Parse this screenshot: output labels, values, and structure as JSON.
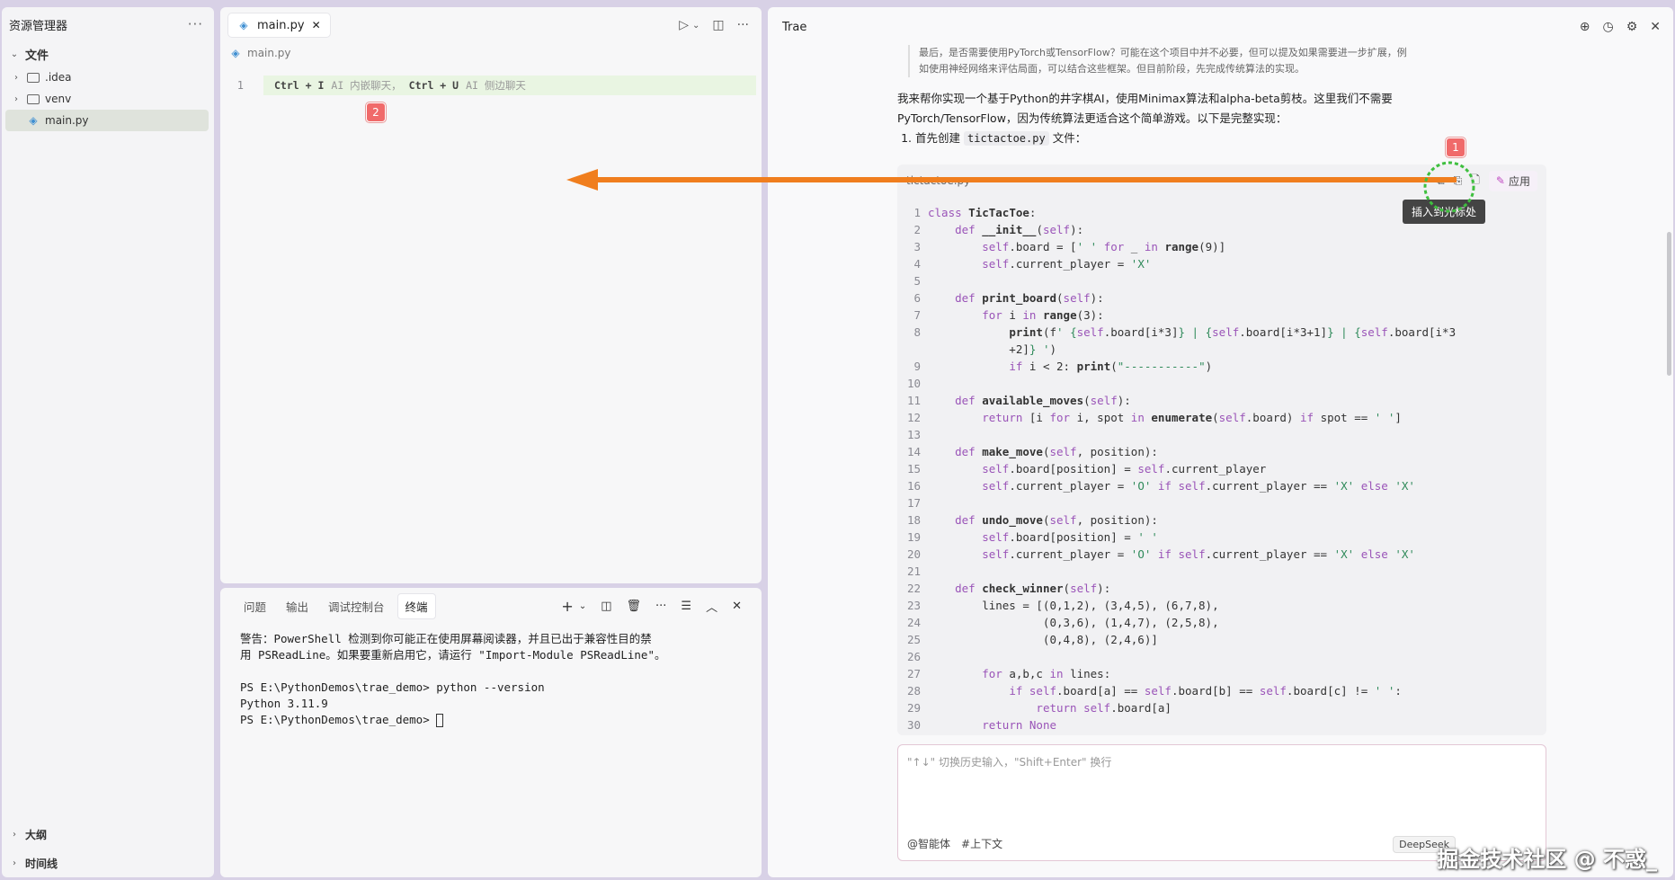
{
  "explorer": {
    "title": "资源管理器",
    "more": "···",
    "section": "文件",
    "items": [
      {
        "label": ".idea",
        "type": "folder"
      },
      {
        "label": "venv",
        "type": "folder"
      },
      {
        "label": "main.py",
        "type": "file"
      }
    ],
    "bottom": [
      {
        "label": "大纲"
      },
      {
        "label": "时间线"
      }
    ]
  },
  "editor": {
    "tab_label": "main.py",
    "tab_close": "✕",
    "breadcrumb": "main.py",
    "line_number": "1",
    "hint_key1": "Ctrl + I",
    "hint_text1": "AI 内嵌聊天，",
    "hint_key2": "Ctrl + U",
    "hint_text2": "AI 侧边聊天",
    "marker2": "2"
  },
  "terminal": {
    "tabs": [
      "问题",
      "输出",
      "调试控制台",
      "终端"
    ],
    "active_tab": "终端",
    "lines": [
      "警告：PowerShell 检测到你可能正在使用屏幕阅读器，并且已出于兼容性目的禁",
      "用 PSReadLine。如果要重新启用它，请运行 \"Import-Module PSReadLine\"。",
      "",
      "PS E:\\PythonDemos\\trae_demo> python --version",
      "Python 3.11.9",
      "PS E:\\PythonDemos\\trae_demo> "
    ]
  },
  "trae": {
    "title": "Trae",
    "thinking": "最后，是否需要使用PyTorch或TensorFlow？可能在这个项目中并不必要，但可以提及如果需要进一步扩展，例如使用神经网络来评估局面，可以结合这些框架。但目前阶段，先完成传统算法的实现。",
    "answer_p": "我来帮你实现一个基于Python的井字棋AI，使用Minimax算法和alpha-beta剪枝。这里我们不需要PyTorch/TensorFlow，因为传统算法更适合这个简单游戏。以下是完整实现：",
    "step1_prefix": "首先创建",
    "step1_code": "tictactoe.py",
    "step1_suffix": "文件：",
    "codeblock_file": "tictactoe.py",
    "apply_label": "应用",
    "tooltip": "插入到光标处",
    "marker1": "1",
    "input_placeholder": "\"↑↓\" 切换历史输入，\"Shift+Enter\" 换行",
    "agent_label": "@智能体",
    "context_label": "#上下文",
    "model_label": "DeepSeek"
  },
  "watermark": "掘金技术社区 @ 不惑_",
  "colors": {
    "arrow": "#f07e1e",
    "highlight_circle": "#3fbf3f",
    "badge": "#f06a6a"
  }
}
